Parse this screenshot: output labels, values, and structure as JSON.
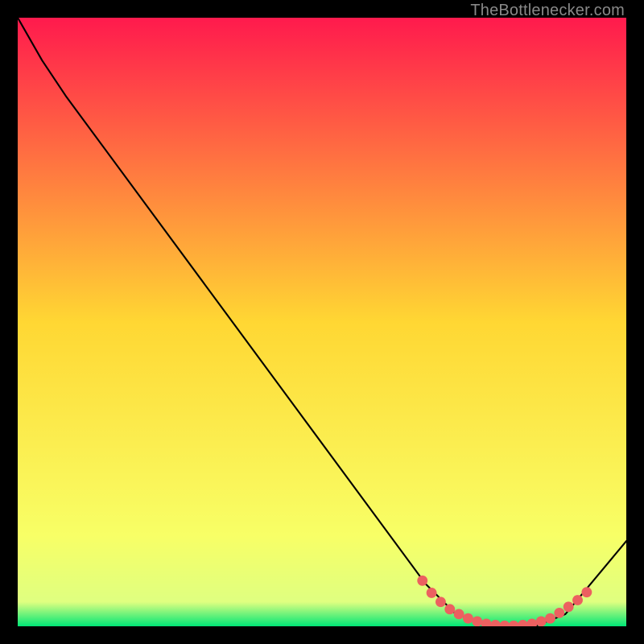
{
  "attribution": "TheBottlenecker.com",
  "chart_data": {
    "type": "line",
    "title": "",
    "xlabel": "",
    "ylabel": "",
    "xlim": [
      0,
      100
    ],
    "ylim": [
      0,
      100
    ],
    "background_gradient_stops": [
      {
        "offset": 0,
        "color": "#ff1a4d"
      },
      {
        "offset": 50,
        "color": "#ffd733"
      },
      {
        "offset": 85,
        "color": "#f8ff66"
      },
      {
        "offset": 96,
        "color": "#dfff80"
      },
      {
        "offset": 100,
        "color": "#00e676"
      }
    ],
    "curve_points_xy": [
      [
        0,
        100
      ],
      [
        4,
        93
      ],
      [
        8,
        87
      ],
      [
        67,
        7
      ],
      [
        72,
        2
      ],
      [
        78,
        0
      ],
      [
        85,
        0
      ],
      [
        90,
        2
      ],
      [
        100,
        14
      ]
    ],
    "valley_marker_points_xy": [
      [
        66.5,
        7.5
      ],
      [
        68,
        5.5
      ],
      [
        69.5,
        4
      ],
      [
        71,
        2.8
      ],
      [
        72.5,
        2
      ],
      [
        74,
        1.3
      ],
      [
        75.5,
        0.8
      ],
      [
        77,
        0.4
      ],
      [
        78.5,
        0.2
      ],
      [
        80,
        0.1
      ],
      [
        81.5,
        0.1
      ],
      [
        83,
        0.2
      ],
      [
        84.5,
        0.4
      ],
      [
        86,
        0.8
      ],
      [
        87.5,
        1.3
      ],
      [
        89,
        2.2
      ],
      [
        90.5,
        3.2
      ],
      [
        92,
        4.3
      ],
      [
        93.5,
        5.6
      ]
    ],
    "marker_color": "#ec6060",
    "curve_color": "#000000"
  }
}
